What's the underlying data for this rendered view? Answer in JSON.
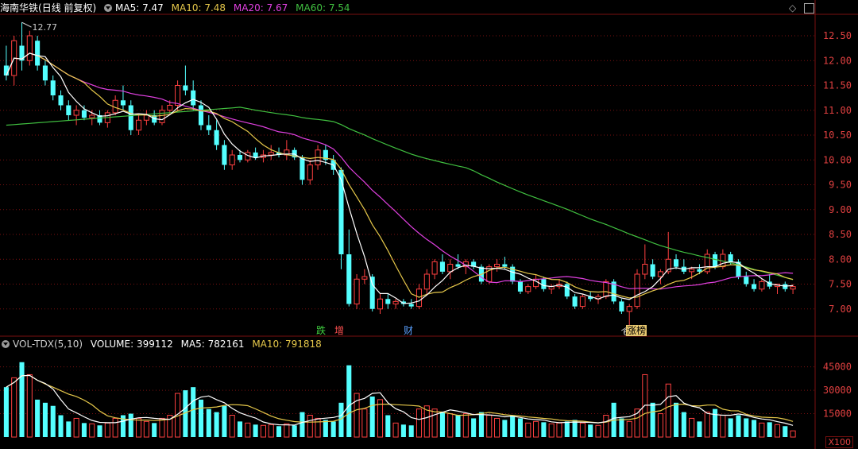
{
  "header": {
    "stock_name": "海南华铁",
    "period": "(日线 前复权)",
    "ma5_label": "MA5: 7.47",
    "ma10_label": "MA10: 7.48",
    "ma20_label": "MA20: 7.67",
    "ma60_label": "MA60: 7.54"
  },
  "volume_header": {
    "indicator": "VOL-TDX(5,10)",
    "volume_label": "VOLUME: 399112",
    "ma5_label": "MA5: 782161",
    "ma10_label": "MA10: 791818"
  },
  "colors": {
    "up": "#ff4040",
    "down": "#54ffff",
    "ma5": "#ffffff",
    "ma10": "#e6c84a",
    "ma20": "#e040e0",
    "ma60": "#40c040",
    "grid": "#7a1010",
    "axis_text": "#e04040"
  },
  "events": {
    "e1": "跌",
    "e2": "增",
    "e3": "财",
    "e4": "涨榜"
  },
  "volume_unit": "X100",
  "chart_data": {
    "type": "candlestick",
    "title": "海南华铁 (日线 前复权)",
    "price_axis": {
      "range": [
        6.5,
        12.9
      ],
      "ticks": [
        7.0,
        7.5,
        8.0,
        8.5,
        9.0,
        9.5,
        10.0,
        10.5,
        11.0,
        11.5,
        12.0,
        12.5
      ]
    },
    "price_tick_labels": [
      "7.00",
      "7.50",
      "8.00",
      "8.50",
      "9.00",
      "9.50",
      "10.00",
      "10.50",
      "11.00",
      "11.50",
      "12.00",
      "12.50"
    ],
    "volume_axis": {
      "range": [
        0,
        55000
      ],
      "ticks": [
        15000,
        30000,
        45000
      ]
    },
    "volume_tick_labels": [
      "15000",
      "30000",
      "45000"
    ],
    "annotations": {
      "high": "12.77",
      "low": "6.66"
    },
    "candles": [
      [
        11.9,
        12.3,
        11.6,
        11.7,
        32000
      ],
      [
        11.7,
        12.5,
        11.5,
        12.4,
        38000
      ],
      [
        12.3,
        12.77,
        11.8,
        12.0,
        48000
      ],
      [
        12.0,
        12.6,
        11.9,
        12.5,
        40000
      ],
      [
        12.4,
        12.5,
        11.8,
        11.9,
        24000
      ],
      [
        11.9,
        12.0,
        11.5,
        11.6,
        22000
      ],
      [
        11.6,
        11.7,
        11.2,
        11.3,
        20000
      ],
      [
        11.3,
        11.4,
        11.0,
        11.1,
        14000
      ],
      [
        11.1,
        11.2,
        10.8,
        10.9,
        10000
      ],
      [
        10.9,
        11.1,
        10.7,
        11.0,
        12000
      ],
      [
        11.0,
        11.1,
        10.8,
        10.85,
        9000
      ],
      [
        10.85,
        11.0,
        10.7,
        10.9,
        8500
      ],
      [
        10.9,
        11.0,
        10.7,
        10.75,
        7500
      ],
      [
        10.75,
        11.0,
        10.65,
        10.95,
        9000
      ],
      [
        10.95,
        11.3,
        10.9,
        11.2,
        12000
      ],
      [
        11.2,
        11.5,
        11.0,
        11.1,
        14000
      ],
      [
        11.1,
        11.2,
        10.5,
        10.6,
        15000
      ],
      [
        10.6,
        10.9,
        10.5,
        10.8,
        12000
      ],
      [
        10.8,
        11.0,
        10.7,
        10.9,
        10000
      ],
      [
        10.9,
        11.0,
        10.7,
        10.75,
        9000
      ],
      [
        10.75,
        11.1,
        10.7,
        11.0,
        12000
      ],
      [
        11.0,
        11.2,
        10.9,
        11.1,
        14000
      ],
      [
        11.1,
        11.6,
        11.0,
        11.5,
        28000
      ],
      [
        11.5,
        11.9,
        11.3,
        11.4,
        30000
      ],
      [
        11.4,
        11.6,
        11.0,
        11.1,
        32000
      ],
      [
        11.1,
        11.2,
        10.6,
        10.7,
        24000
      ],
      [
        10.7,
        10.9,
        10.5,
        10.6,
        18000
      ],
      [
        10.6,
        10.8,
        10.2,
        10.3,
        16000
      ],
      [
        10.3,
        10.4,
        9.8,
        9.9,
        20000
      ],
      [
        9.9,
        10.2,
        9.8,
        10.1,
        14000
      ],
      [
        10.1,
        10.2,
        9.95,
        10.0,
        10000
      ],
      [
        10.0,
        10.2,
        9.95,
        10.15,
        9000
      ],
      [
        10.15,
        10.25,
        10.0,
        10.05,
        8000
      ],
      [
        10.05,
        10.2,
        9.95,
        10.1,
        7500
      ],
      [
        10.1,
        10.3,
        10.0,
        10.15,
        8000
      ],
      [
        10.15,
        10.25,
        10.05,
        10.1,
        7000
      ],
      [
        10.1,
        10.4,
        10.0,
        10.2,
        8500
      ],
      [
        10.2,
        10.25,
        10.0,
        10.05,
        7500
      ],
      [
        10.05,
        10.1,
        9.5,
        9.6,
        16000
      ],
      [
        9.6,
        10.0,
        9.5,
        9.9,
        14000
      ],
      [
        9.9,
        10.3,
        9.8,
        10.2,
        12000
      ],
      [
        10.2,
        10.3,
        9.9,
        10.0,
        11000
      ],
      [
        10.0,
        10.1,
        9.7,
        9.8,
        10000
      ],
      [
        9.8,
        9.85,
        7.8,
        8.1,
        22000
      ],
      [
        8.1,
        8.6,
        7.05,
        7.1,
        46000
      ],
      [
        7.1,
        7.7,
        7.0,
        7.6,
        28000
      ],
      [
        7.6,
        7.8,
        7.5,
        7.65,
        18000
      ],
      [
        7.65,
        7.7,
        6.95,
        7.0,
        26000
      ],
      [
        7.0,
        7.3,
        6.9,
        7.2,
        24000
      ],
      [
        7.2,
        7.3,
        7.0,
        7.1,
        14000
      ],
      [
        7.1,
        7.2,
        7.0,
        7.15,
        9000
      ],
      [
        7.15,
        7.2,
        7.05,
        7.1,
        8000
      ],
      [
        7.1,
        7.2,
        7.0,
        7.05,
        7500
      ],
      [
        7.05,
        7.5,
        7.0,
        7.4,
        18000
      ],
      [
        7.4,
        7.8,
        7.3,
        7.7,
        20000
      ],
      [
        7.7,
        8.0,
        7.6,
        7.95,
        18000
      ],
      [
        7.95,
        8.1,
        7.7,
        7.75,
        16000
      ],
      [
        7.75,
        8.0,
        7.6,
        7.9,
        15000
      ],
      [
        7.9,
        8.1,
        7.8,
        7.85,
        14000
      ],
      [
        7.85,
        8.0,
        7.7,
        7.95,
        15000
      ],
      [
        7.95,
        8.0,
        7.8,
        7.85,
        12000
      ],
      [
        7.85,
        7.9,
        7.5,
        7.55,
        16000
      ],
      [
        7.55,
        7.9,
        7.5,
        7.85,
        14000
      ],
      [
        7.85,
        8.0,
        7.75,
        7.9,
        12000
      ],
      [
        7.9,
        8.05,
        7.8,
        7.85,
        11000
      ],
      [
        7.85,
        7.9,
        7.5,
        7.55,
        14000
      ],
      [
        7.55,
        7.6,
        7.3,
        7.35,
        12000
      ],
      [
        7.35,
        7.5,
        7.3,
        7.45,
        9000
      ],
      [
        7.45,
        7.7,
        7.4,
        7.6,
        10000
      ],
      [
        7.6,
        7.65,
        7.35,
        7.4,
        9500
      ],
      [
        7.4,
        7.5,
        7.3,
        7.45,
        8500
      ],
      [
        7.45,
        7.6,
        7.4,
        7.5,
        9000
      ],
      [
        7.5,
        7.55,
        7.2,
        7.25,
        10000
      ],
      [
        7.25,
        7.3,
        7.0,
        7.05,
        11000
      ],
      [
        7.05,
        7.3,
        7.0,
        7.25,
        9000
      ],
      [
        7.25,
        7.35,
        7.15,
        7.2,
        8000
      ],
      [
        7.2,
        7.3,
        7.1,
        7.25,
        7500
      ],
      [
        7.25,
        7.6,
        7.2,
        7.55,
        14000
      ],
      [
        7.55,
        7.6,
        7.1,
        7.15,
        22000
      ],
      [
        7.15,
        7.2,
        6.9,
        6.95,
        12000
      ],
      [
        6.95,
        7.1,
        6.66,
        7.05,
        10000
      ],
      [
        7.05,
        7.8,
        7.0,
        7.7,
        18000
      ],
      [
        7.7,
        8.3,
        7.6,
        7.9,
        40000
      ],
      [
        7.9,
        8.0,
        7.6,
        7.65,
        22000
      ],
      [
        7.65,
        7.8,
        7.5,
        7.75,
        15000
      ],
      [
        7.75,
        8.55,
        7.7,
        8.0,
        34000
      ],
      [
        8.0,
        8.1,
        7.8,
        7.85,
        22000
      ],
      [
        7.85,
        8.0,
        7.7,
        7.75,
        16000
      ],
      [
        7.75,
        7.85,
        7.6,
        7.8,
        12000
      ],
      [
        7.8,
        7.9,
        7.7,
        7.75,
        10000
      ],
      [
        7.75,
        8.2,
        7.7,
        8.1,
        16000
      ],
      [
        8.1,
        8.15,
        7.8,
        7.85,
        18000
      ],
      [
        7.85,
        8.2,
        7.8,
        8.1,
        14000
      ],
      [
        8.1,
        8.15,
        7.9,
        7.95,
        12000
      ],
      [
        7.95,
        8.0,
        7.6,
        7.65,
        14000
      ],
      [
        7.65,
        7.75,
        7.45,
        7.5,
        12000
      ],
      [
        7.5,
        7.6,
        7.35,
        7.4,
        11000
      ],
      [
        7.4,
        7.6,
        7.35,
        7.55,
        9000
      ],
      [
        7.55,
        7.7,
        7.4,
        7.45,
        9500
      ],
      [
        7.45,
        7.5,
        7.3,
        7.5,
        8000
      ],
      [
        7.5,
        7.55,
        7.35,
        7.4,
        7000
      ],
      [
        7.4,
        7.5,
        7.3,
        7.45,
        4000
      ]
    ]
  }
}
